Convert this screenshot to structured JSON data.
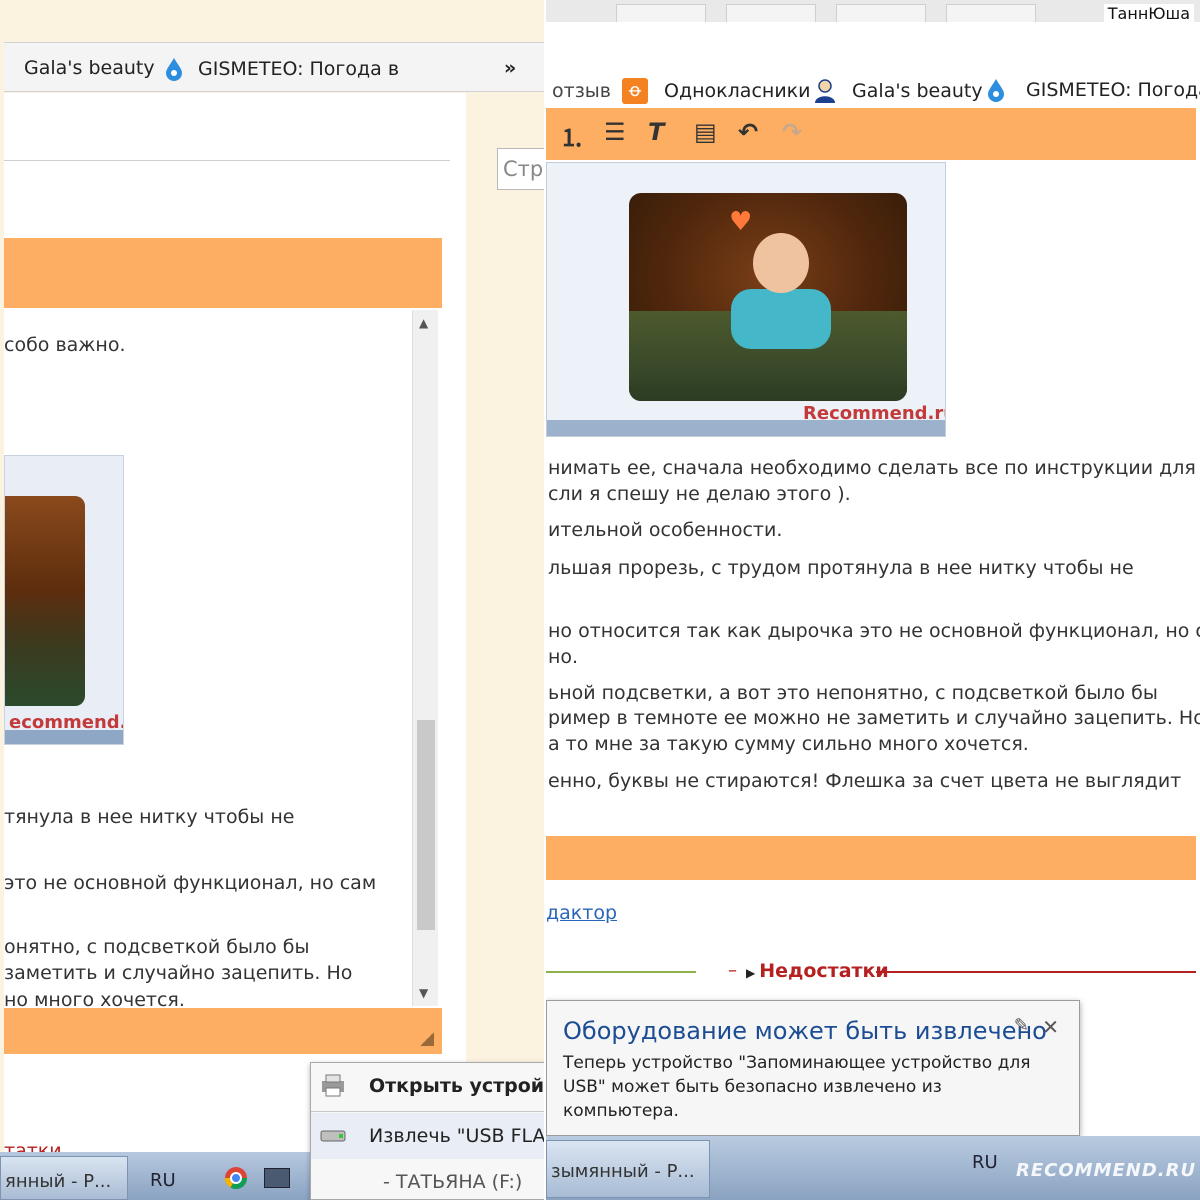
{
  "left": {
    "bookmarks": [
      "Gala's beauty",
      "GISMETEO: Погода в"
    ],
    "more": "»",
    "search_placeholder": "Стр",
    "lines": [
      "собо важно.",
      "тянула в нее нитку чтобы не",
      "это не основной функционал, но сам",
      "онятно, с подсветкой было бы",
      " заметить и случайно зацепить. Но",
      "но много хочется."
    ],
    "watermark": "ecommend.ru",
    "red_label": "татки",
    "popup": {
      "open_device": "Открыть устройст",
      "eject": "Извлечь \"USB FLAS",
      "drive": "- ТАТЬЯНА (F:)"
    },
    "taskbar_item": "янный - Р...",
    "lang": "RU"
  },
  "right": {
    "user": "ТаннЮша",
    "bookmarks": [
      "отзыв",
      "Однокласники",
      "Gala's beauty",
      "GISMETEO: Погода в"
    ],
    "screenshot_logo": "Recommend.ru",
    "lines": [
      "нимать ее, сначала необходимо сделать все по инструкции для",
      "сли я спешу не делаю этого ).",
      "ительной особенности.",
      "льшая прорезь, с трудом протянула в нее нитку чтобы не",
      "но относится так как дырочка это не основной функционал, но сам",
      "но.",
      "ьной подсветки, а вот это непонятно, с подсветкой было бы",
      "ример в темноте ее можно не заметить и случайно зацепить. Но",
      "а то мне за такую сумму сильно много хочется.",
      "енно, буквы не стираются! Флешка за счет цвета не выглядит"
    ],
    "editor_link": "дактор",
    "negatives_dash": "–",
    "negatives_label": "Недостатки",
    "notification": {
      "title": "Оборудование может быть извлечено",
      "body": "Теперь устройство \"Запоминающее устройство для USB\" может быть безопасно извлечено из компьютера.",
      "close": "✕"
    },
    "taskbar_item": "зымянный - Р...",
    "lang": "RU",
    "watermark": "RECOMMEND.RU"
  },
  "colors": {
    "orange": "#fdae63",
    "link": "#2a66b8",
    "negative": "#b52020",
    "notif_title": "#1c4d94"
  }
}
